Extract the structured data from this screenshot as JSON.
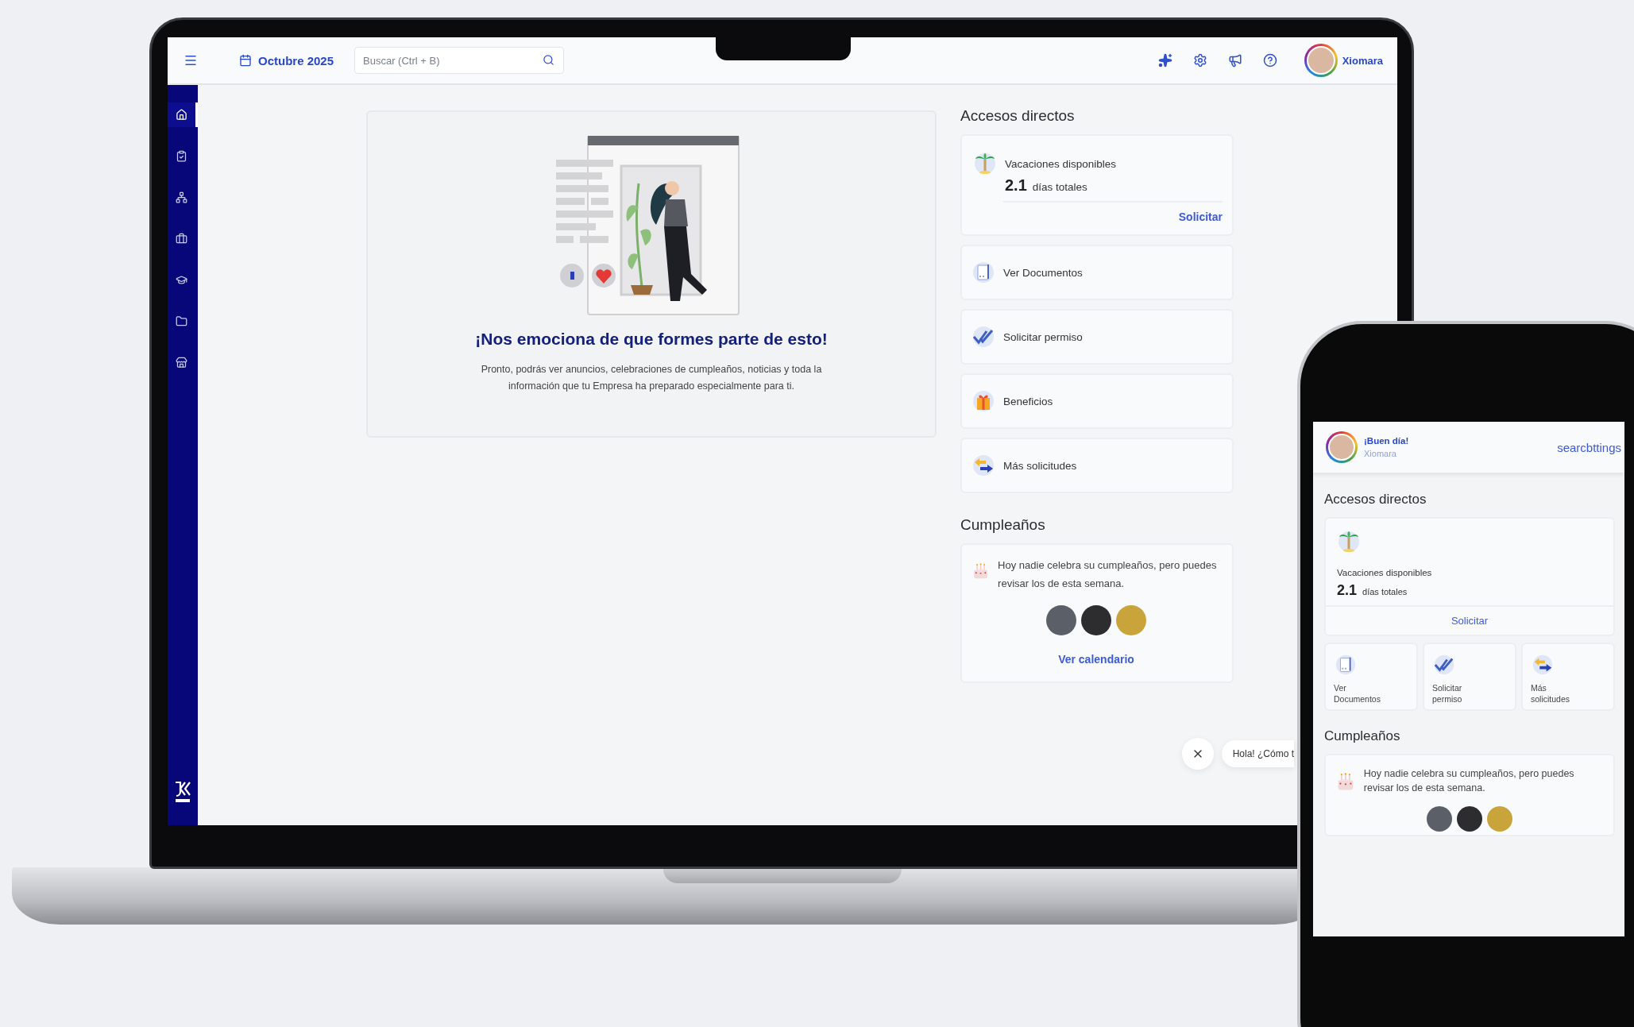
{
  "laptop": {
    "topbar": {
      "date": "Octubre 2025",
      "search": {
        "placeholder": "Buscar (Ctrl + B)"
      },
      "user": "Xiomara"
    },
    "sidebar": {
      "items": [
        {
          "selected": true
        },
        {
          "selected": false
        },
        {
          "selected": false
        },
        {
          "selected": false
        },
        {
          "selected": false
        },
        {
          "selected": false
        },
        {
          "selected": false
        }
      ]
    },
    "welcome": {
      "title": "¡Nos emociona de que formes parte de esto!",
      "text": "Pronto, podrás ver anuncios, celebraciones de cumpleaños, noticias y toda la información que tu Empresa ha preparado especialmente para ti."
    },
    "shortcuts": {
      "title": "Accesos directos",
      "vacation": {
        "label": "Vacaciones disponibles",
        "value": "2.1",
        "unit": "días totales",
        "action": "Solicitar"
      },
      "items": [
        {
          "kind": "documents",
          "label": "Ver Documentos"
        },
        {
          "kind": "permission",
          "label": "Solicitar permiso"
        },
        {
          "kind": "benefits",
          "label": "Beneficios"
        },
        {
          "kind": "requests",
          "label": "Más solicitudes"
        }
      ]
    },
    "birthdays": {
      "title": "Cumpleaños",
      "text": "Hoy nadie celebra su cumpleaños, pero puedes revisar los de esta semana.",
      "action": "Ver calendario"
    },
    "chat": {
      "text": "Hola! ¿Cómo t"
    }
  },
  "phone": {
    "greeting": "¡Buen día!",
    "user": "Xiomara",
    "header_action": "searcbttings",
    "shortcuts": {
      "title": "Accesos directos",
      "vacation": {
        "label": "Vacaciones disponibles",
        "value": "2.1",
        "unit": "días totales",
        "action": "Solicitar"
      },
      "items": [
        {
          "kind": "documents",
          "label": "Ver Documentos"
        },
        {
          "kind": "permission",
          "label": "Solicitar permiso"
        },
        {
          "kind": "requests",
          "label": "Más solicitudes"
        }
      ]
    },
    "birthdays": {
      "title": "Cumpleaños",
      "text": "Hoy nadie celebra su cumpleaños, pero puedes revisar los de esta semana."
    }
  }
}
